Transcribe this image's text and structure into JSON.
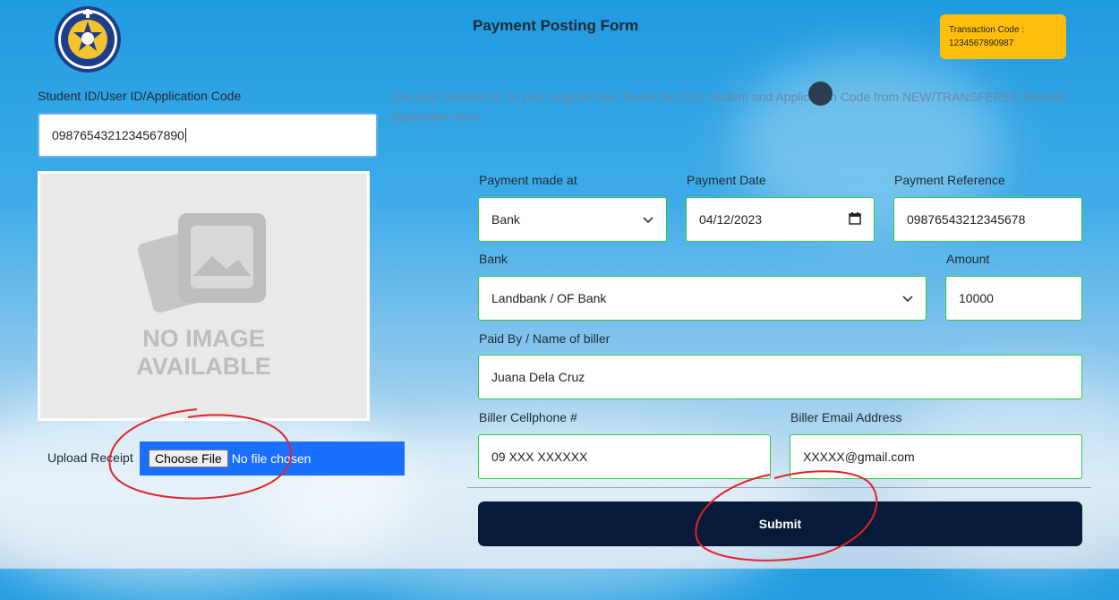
{
  "header": {
    "title": "Payment Posting Form",
    "transaction_label": "Transaction Code :",
    "transaction_code": "1234567890987"
  },
  "logo": {
    "name": "ST. THERESITA'S ACADEMY OF SILAY CITY, INC.",
    "year": "1933"
  },
  "student": {
    "label": "Student ID/User ID/Application Code",
    "value": "0987654321234567890",
    "help_text": "Use your Student ID or your original User Name for OLD student and Application Code from NEW/TRANSFEREE Student Application form."
  },
  "receipt": {
    "no_image_line1": "NO IMAGE",
    "no_image_line2": "AVAILABLE",
    "upload_label": "Upload Receipt",
    "choose_file": "Choose File",
    "no_file": "No file chosen"
  },
  "payment": {
    "made_at_label": "Payment made at",
    "made_at_value": "Bank",
    "date_label": "Payment Date",
    "date_value": "04/12/2023",
    "reference_label": "Payment Reference",
    "reference_value": "09876543212345678",
    "bank_label": "Bank",
    "bank_value": "Landbank / OF Bank",
    "amount_label": "Amount",
    "amount_value": "10000",
    "paid_by_label": "Paid By / Name of biller",
    "paid_by_value": "Juana Dela Cruz",
    "cellphone_label": "Biller Cellphone #",
    "cellphone_value": "09 XXX XXXXXX",
    "email_label": "Biller Email Address",
    "email_value": "XXXXX@gmail.com"
  },
  "submit_label": "Submit",
  "colors": {
    "accent_border": "#2ecc40",
    "submit_bg": "#081a3a",
    "upload_bg": "#1a6fff",
    "transaction_bg": "#ffbe0b",
    "annotation": "#e0242a"
  },
  "icons": {
    "dropdown": "chevron-down-icon",
    "date": "calendar-icon"
  }
}
